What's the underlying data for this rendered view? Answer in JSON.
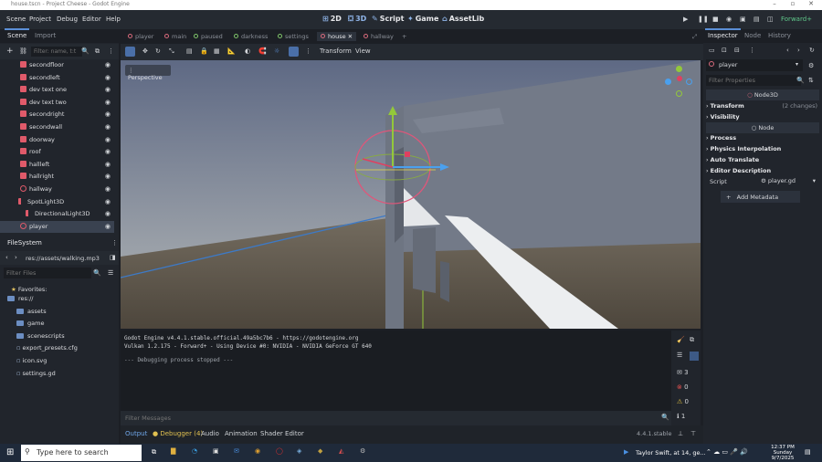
{
  "window": {
    "title": "house.tscn - Project Cheese - Godot Engine",
    "minimize": "–",
    "maximize": "▫",
    "close": "✕"
  },
  "menu": [
    "Scene",
    "Project",
    "Debug",
    "Editor",
    "Help"
  ],
  "workspaces": [
    {
      "label": "2D",
      "icon": "2d-icon"
    },
    {
      "label": "3D",
      "icon": "3d-icon"
    },
    {
      "label": "Script",
      "icon": "script-icon"
    },
    {
      "label": "Game",
      "icon": "game-icon"
    },
    {
      "label": "AssetLib",
      "icon": "assetlib-icon"
    }
  ],
  "renderer": "Forward+",
  "scene_dock": {
    "tabs": [
      "Scene",
      "Import"
    ],
    "filter_placeholder": "Filter: name, t:t",
    "nodes": [
      {
        "label": "secondfloor",
        "type": "mesh"
      },
      {
        "label": "secondleft",
        "type": "mesh"
      },
      {
        "label": "dev text one",
        "type": "mesh"
      },
      {
        "label": "dev text two",
        "type": "mesh"
      },
      {
        "label": "secondright",
        "type": "mesh"
      },
      {
        "label": "secondwall",
        "type": "mesh"
      },
      {
        "label": "doorway",
        "type": "mesh"
      },
      {
        "label": "roof",
        "type": "mesh"
      },
      {
        "label": "hallleft",
        "type": "mesh"
      },
      {
        "label": "hallright",
        "type": "mesh"
      },
      {
        "label": "hallway",
        "type": "node3d"
      },
      {
        "label": "SpotLight3D",
        "type": "light"
      },
      {
        "label": "DirectionalLight3D",
        "type": "light"
      },
      {
        "label": "player",
        "type": "node3d"
      }
    ]
  },
  "filesystem": {
    "title": "FileSystem",
    "path": "res://assets/walking.mp3",
    "filter_placeholder": "Filter Files",
    "favorites": "Favorites:",
    "items": [
      {
        "label": "res://",
        "kind": "folder"
      },
      {
        "label": "assets",
        "kind": "folder"
      },
      {
        "label": "game",
        "kind": "folder"
      },
      {
        "label": "scenescripts",
        "kind": "folder"
      },
      {
        "label": "export_presets.cfg",
        "kind": "file"
      },
      {
        "label": "icon.svg",
        "kind": "file"
      },
      {
        "label": "settings.gd",
        "kind": "file"
      }
    ]
  },
  "scene_tabs": [
    {
      "label": "player",
      "active": false
    },
    {
      "label": "main",
      "active": false
    },
    {
      "label": "paused",
      "active": false
    },
    {
      "label": "darkness",
      "active": false
    },
    {
      "label": "settings",
      "active": false
    },
    {
      "label": "house",
      "active": true
    },
    {
      "label": "hallway",
      "active": false
    }
  ],
  "viewport": {
    "menus": [
      "Transform",
      "View"
    ],
    "perspective": "Perspective"
  },
  "output": {
    "lines": [
      "Godot Engine v4.4.1.stable.official.49a5bc7b6 - https://godotengine.org",
      "Vulkan 1.2.175 - Forward+ - Using Device #0: NVIDIA - NVIDIA GeForce GT 640",
      "",
      "--- Debugging process stopped ---"
    ],
    "filter_placeholder": "Filter Messages",
    "counts": {
      "messages": "3",
      "errors": "0",
      "warnings": "0",
      "info": "1"
    }
  },
  "bottom_tabs": [
    "Output",
    "Debugger (4)",
    "Audio",
    "Animation",
    "Shader Editor"
  ],
  "version": "4.4.1.stable",
  "inspector": {
    "tabs": [
      "Inspector",
      "Node",
      "History"
    ],
    "object": "player",
    "filter_placeholder": "Filter Properties",
    "class": "Node3D",
    "sections": [
      {
        "label": "Transform",
        "note": "(2 changes)"
      },
      {
        "label": "Visibility",
        "note": ""
      }
    ],
    "node_class": "Node",
    "node_sections": [
      "Process",
      "Physics Interpolation",
      "Auto Translate",
      "Editor Description"
    ],
    "script_label": "Script",
    "script_value": "player.gd",
    "add_metadata": "Add Metadata"
  },
  "taskbar": {
    "search_placeholder": "Type here to search",
    "now_playing": "Taylor Swift, at 14, ge...",
    "time": "12:37 PM",
    "day": "Sunday",
    "date": "9/7/2025"
  },
  "colors": {
    "accent": "#5b8fd6",
    "bg": "#21252c",
    "sky_top": "#5f6a82",
    "ground": "#5e5648"
  }
}
